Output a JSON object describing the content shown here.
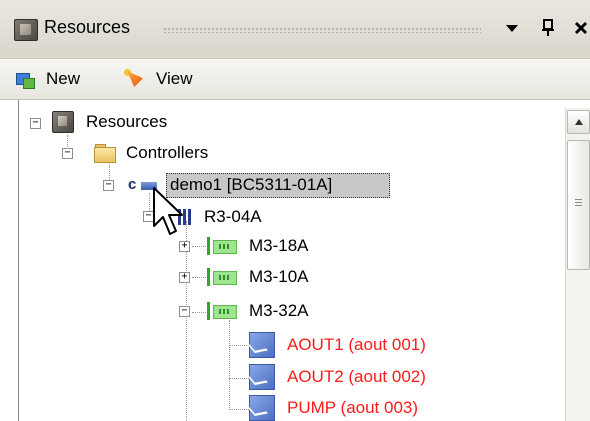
{
  "panel": {
    "title": "Resources",
    "buttons": {
      "dropdown": "▾",
      "pin": "ᵖ",
      "close": "✕"
    }
  },
  "toolbar": {
    "new_label": "New",
    "view_label": "View"
  },
  "tree": {
    "root": {
      "label": "Resources",
      "expander": "−"
    },
    "controllers": {
      "label": "Controllers",
      "expander": "−"
    },
    "controller": {
      "label": "demo1 [BC5311-01A]",
      "expander": "−",
      "selected": true
    },
    "bus": {
      "label": "R3-04A",
      "expander": "−"
    },
    "modules": [
      {
        "label": "M3-18A",
        "expander": "+"
      },
      {
        "label": "M3-10A",
        "expander": "+"
      },
      {
        "label": "M3-32A",
        "expander": "−"
      }
    ],
    "channels": [
      {
        "label": "AOUT1 (aout 001)",
        "color": "#ff1a1a"
      },
      {
        "label": "AOUT2 (aout 002)",
        "color": "#ff1a1a"
      },
      {
        "label": "PUMP (aout 003)",
        "color": "#ff1a1a"
      }
    ]
  },
  "colors": {
    "selection": "#c8c8c8",
    "channel_text": "#ff1a1a"
  }
}
